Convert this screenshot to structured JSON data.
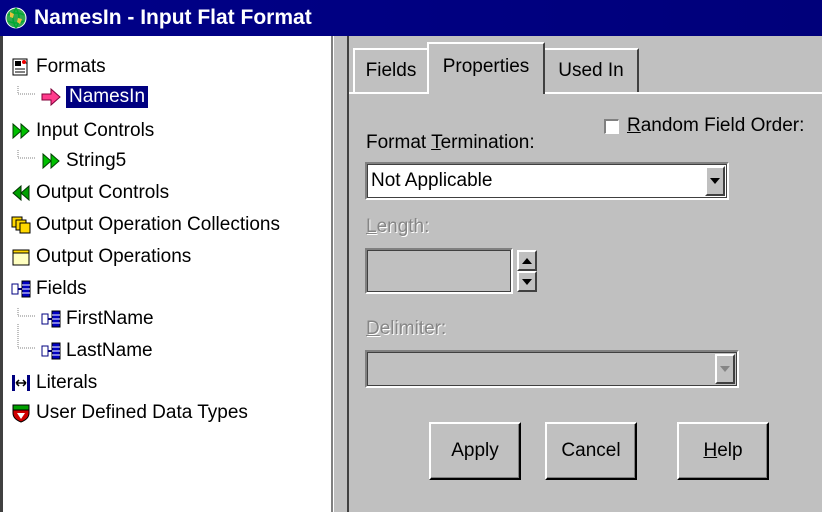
{
  "window": {
    "title": "NamesIn - Input Flat Format",
    "icon": "globe-icon"
  },
  "tree": {
    "items": [
      {
        "label": "Formats",
        "icon": "formats-icon",
        "level": 0
      },
      {
        "label": "NamesIn",
        "icon": "pink-arrow-icon",
        "level": 1,
        "selected": true
      },
      {
        "label": "Input Controls",
        "icon": "input-control-icon",
        "level": 0
      },
      {
        "label": "String5",
        "icon": "input-control-icon",
        "level": 1
      },
      {
        "label": "Output Controls",
        "icon": "output-control-icon",
        "level": 0
      },
      {
        "label": "Output Operation Collections",
        "icon": "collection-icon",
        "level": 0
      },
      {
        "label": "Output Operations",
        "icon": "folder-icon",
        "level": 0
      },
      {
        "label": "Fields",
        "icon": "field-icon",
        "level": 0
      },
      {
        "label": "FirstName",
        "icon": "field-icon",
        "level": 1
      },
      {
        "label": "LastName",
        "icon": "field-icon",
        "level": 1
      },
      {
        "label": "Literals",
        "icon": "literal-icon",
        "level": 0
      },
      {
        "label": "User Defined Data Types",
        "icon": "shield-icon",
        "level": 0
      }
    ]
  },
  "tabs": [
    {
      "label": "Fields",
      "active": false
    },
    {
      "label": "Properties",
      "active": true
    },
    {
      "label": "Used In",
      "active": false
    }
  ],
  "properties": {
    "random_field_order": {
      "label_prefix": "",
      "label_hotkey": "R",
      "label_rest": "andom Field Order:",
      "checked": false
    },
    "format_termination": {
      "label_prefix": "Format ",
      "label_hotkey": "T",
      "label_rest": "ermination:",
      "value": "Not Applicable"
    },
    "length": {
      "label_prefix": "",
      "label_hotkey": "L",
      "label_rest": "ength:",
      "value": "",
      "enabled": false
    },
    "delimiter": {
      "label_prefix": "",
      "label_hotkey": "D",
      "label_rest": "elimiter:",
      "value": "",
      "enabled": false
    }
  },
  "buttons": {
    "apply": "Apply",
    "cancel": "Cancel",
    "help_hotkey": "H",
    "help_rest": "elp"
  },
  "colors": {
    "titlebar": "#000080",
    "selection": "#000080",
    "dialog_face": "#c0c0c0",
    "disabled_text": "#868686"
  }
}
